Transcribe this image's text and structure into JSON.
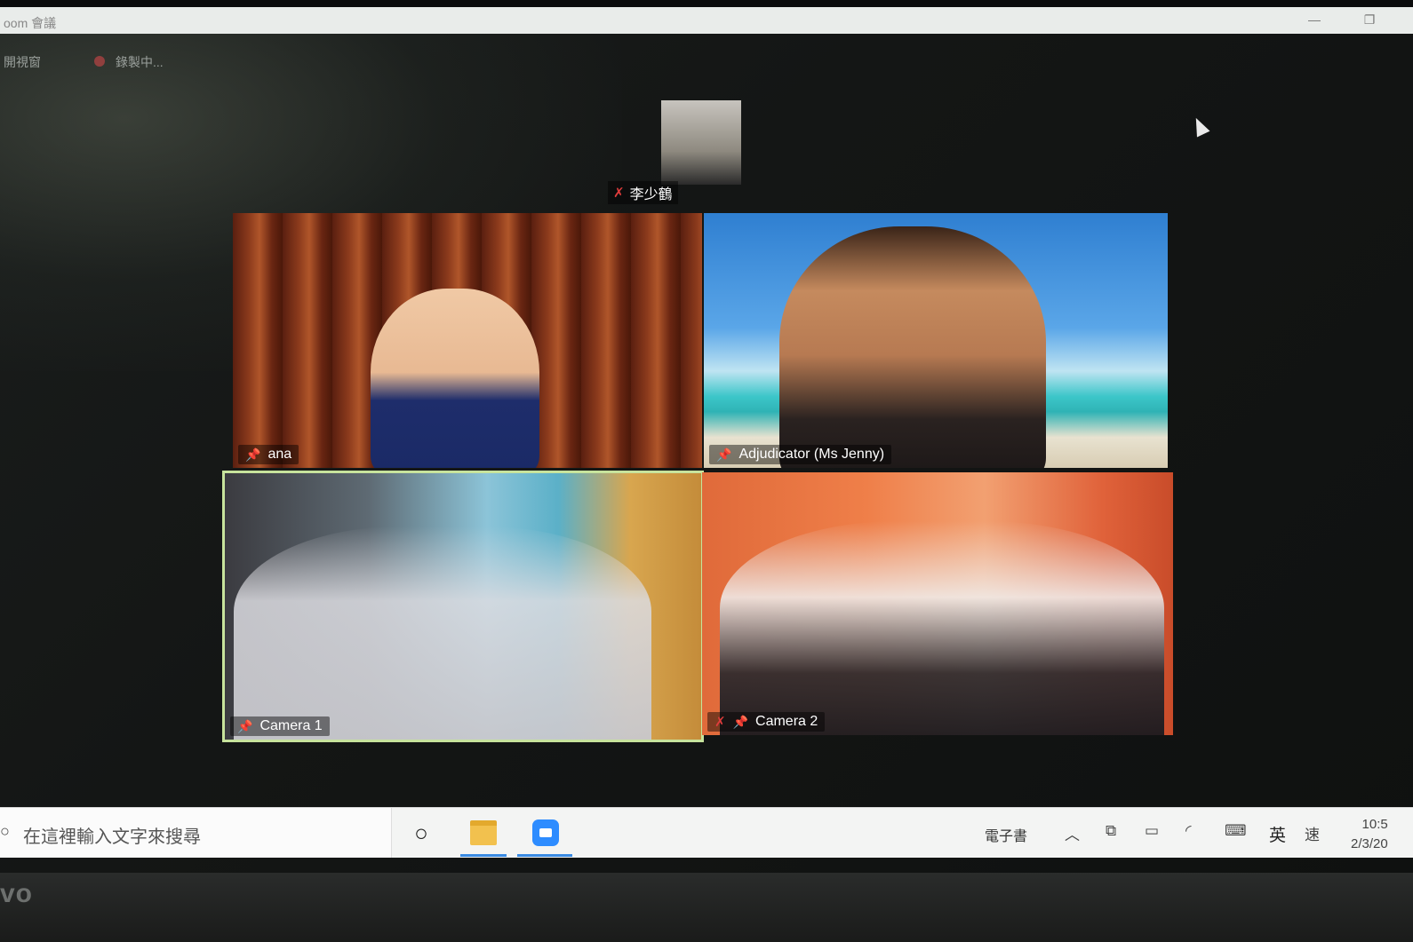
{
  "window": {
    "title": "oom 會議"
  },
  "meeting_bar": {
    "view_label": "開視窗",
    "recording_label": "錄製中..."
  },
  "self_view": {
    "name": "李少鶴",
    "muted": true
  },
  "participants": [
    {
      "name": "ana",
      "pinned": true,
      "muted": false
    },
    {
      "name": "Adjudicator (Ms Jenny)",
      "pinned": true,
      "muted": false
    },
    {
      "name": "Camera 1",
      "pinned": true,
      "muted": false,
      "active_speaker": true
    },
    {
      "name": "Camera 2",
      "pinned": true,
      "muted": true
    }
  ],
  "taskbar": {
    "search_placeholder": "在這裡輸入文字來搜尋",
    "ebook_label": "電子書",
    "ime_mode": "英",
    "ime_speed": "速",
    "clock_time": "10:5",
    "clock_date": "2/3/20"
  },
  "brand": {
    "text": "vo"
  },
  "colors": {
    "active_border": "#c7e39c",
    "zoom_blue": "#2d8cff",
    "muted_red": "#e03c3c"
  }
}
